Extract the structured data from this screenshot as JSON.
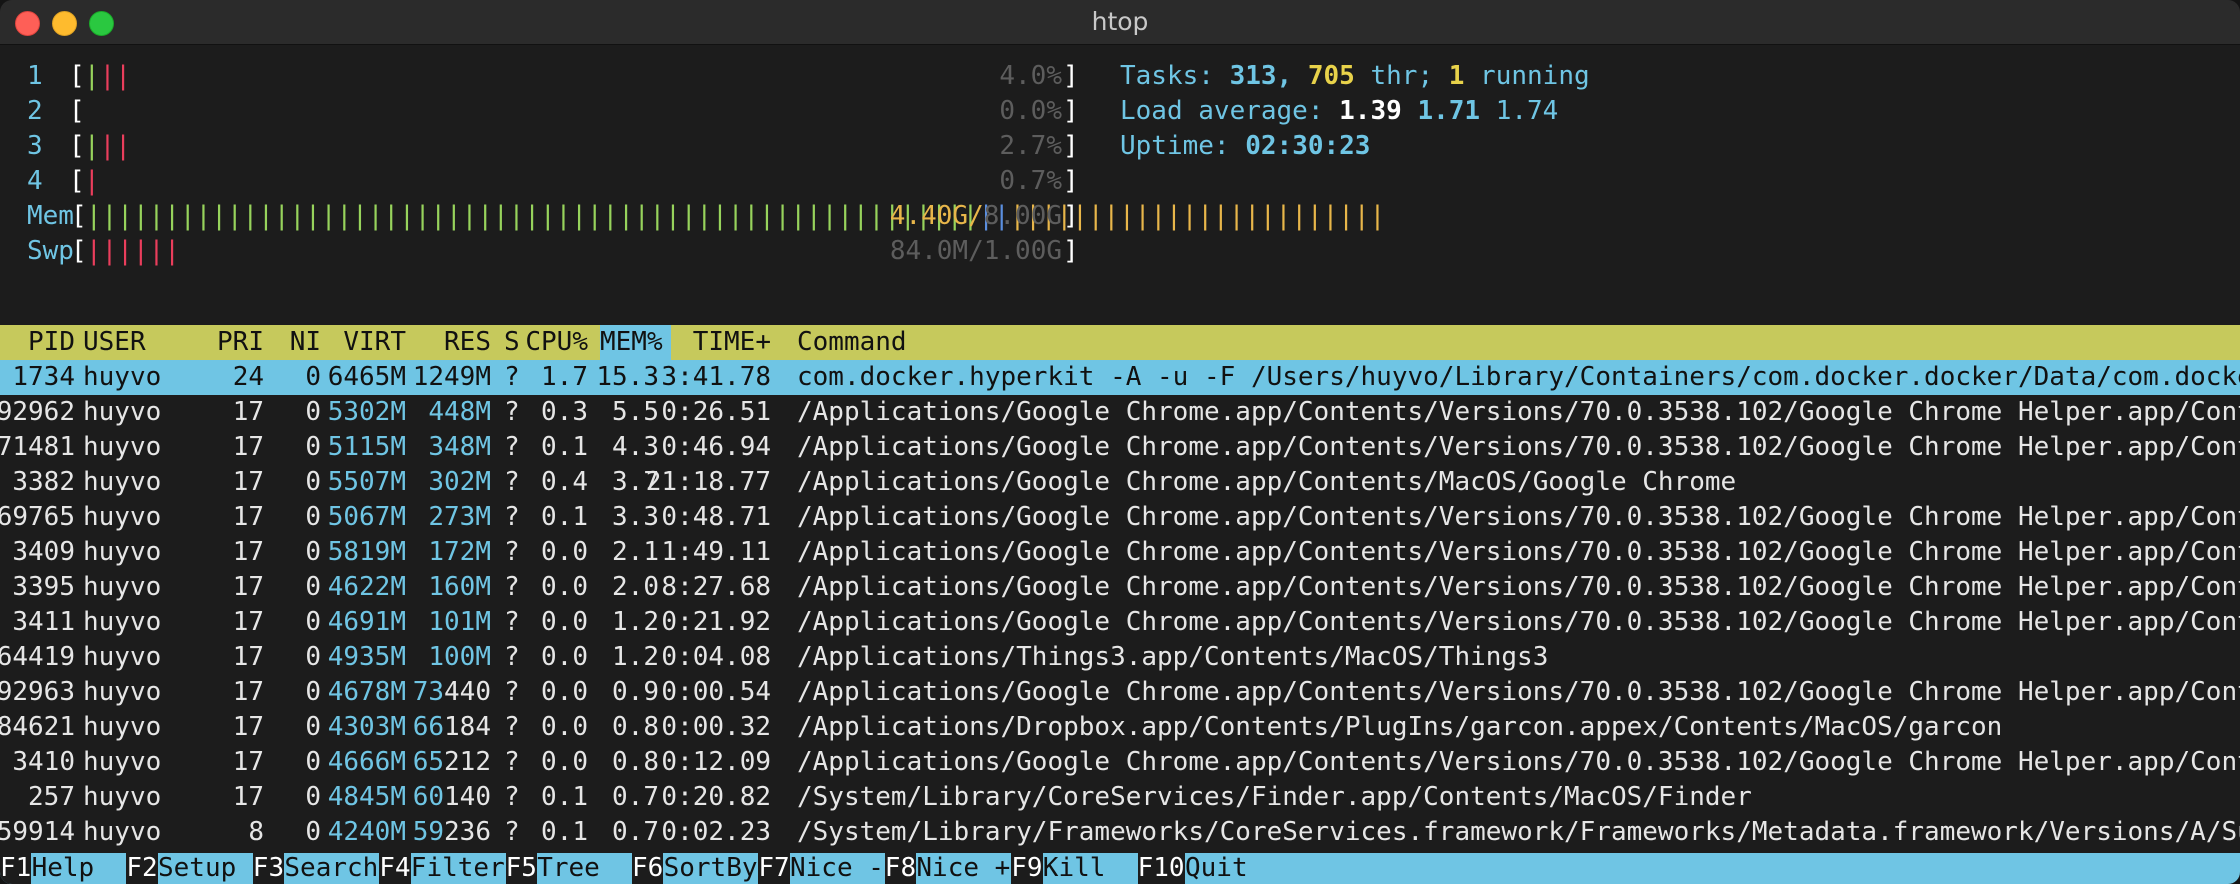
{
  "window": {
    "title": "htop"
  },
  "meters": {
    "cpus": [
      {
        "label": "1",
        "bars": [
          [
            "g",
            1
          ],
          [
            "r",
            2
          ]
        ],
        "value": "4.0%"
      },
      {
        "label": "2",
        "bars": [],
        "value": "0.0%"
      },
      {
        "label": "3",
        "bars": [
          [
            "g",
            1
          ],
          [
            "r",
            2
          ]
        ],
        "value": "2.7%"
      },
      {
        "label": "4",
        "bars": [
          [
            "r",
            1
          ]
        ],
        "value": "0.7%"
      }
    ],
    "mem": {
      "label": "Mem",
      "bars": [
        [
          "g",
          57
        ],
        [
          "b",
          2
        ],
        [
          "y",
          24
        ]
      ],
      "value_used": "4.40G/",
      "value_total": "8.00G"
    },
    "swp": {
      "label": "Swp",
      "bars": [
        [
          "r",
          6
        ]
      ],
      "value": "84.0M/1.00G"
    }
  },
  "info": {
    "tasks_label": "Tasks: ",
    "tasks": "313",
    "sep": ", ",
    "threads": "705",
    "thr_label": " thr; ",
    "running": "1",
    "running_label": " running",
    "load_label": "Load average: ",
    "load1": "1.39",
    "load5": "1.71",
    "load15": "1.74",
    "uptime_label": "Uptime: ",
    "uptime": "02:30:23"
  },
  "columns": [
    "PID",
    "USER",
    "PRI",
    "NI",
    "VIRT",
    "RES",
    "S",
    "CPU%",
    "MEM%",
    "TIME+",
    "Command"
  ],
  "processes": [
    {
      "pid": "1734",
      "user": "huyvo",
      "pri": "24",
      "ni": "0",
      "virt": "6465M",
      "res": "1249M",
      "s": "?",
      "cpu": "1.7",
      "mem": "15.3",
      "time": "3:41.78",
      "cmd": "com.docker.hyperkit -A -u -F /Users/huyvo/Library/Containers/com.docker.docker/Data/com.docker.driver.amd64-linux/hyperkit.pid",
      "selected": true
    },
    {
      "pid": "92962",
      "user": "huyvo",
      "pri": "17",
      "ni": "0",
      "virt": "5302M",
      "res": "448M",
      "s": "?",
      "cpu": "0.3",
      "mem": "5.5",
      "time": "0:26.51",
      "cmd": "/Applications/Google Chrome.app/Contents/Versions/70.0.3538.102/Google Chrome Helper.app/Contents/MacOS/Google Chrome Helper"
    },
    {
      "pid": "71481",
      "user": "huyvo",
      "pri": "17",
      "ni": "0",
      "virt": "5115M",
      "res": "348M",
      "s": "?",
      "cpu": "0.1",
      "mem": "4.3",
      "time": "0:46.94",
      "cmd": "/Applications/Google Chrome.app/Contents/Versions/70.0.3538.102/Google Chrome Helper.app/Contents/MacOS/Google Chrome Helper"
    },
    {
      "pid": "3382",
      "user": "huyvo",
      "pri": "17",
      "ni": "0",
      "virt": "5507M",
      "res": "302M",
      "s": "?",
      "cpu": "0.4",
      "mem": "3.7",
      "time": "21:18.77",
      "cmd": "/Applications/Google Chrome.app/Contents/MacOS/Google Chrome"
    },
    {
      "pid": "69765",
      "user": "huyvo",
      "pri": "17",
      "ni": "0",
      "virt": "5067M",
      "res": "273M",
      "s": "?",
      "cpu": "0.1",
      "mem": "3.3",
      "time": "0:48.71",
      "cmd": "/Applications/Google Chrome.app/Contents/Versions/70.0.3538.102/Google Chrome Helper.app/Contents/MacOS/Google Chrome Helper"
    },
    {
      "pid": "3409",
      "user": "huyvo",
      "pri": "17",
      "ni": "0",
      "virt": "5819M",
      "res": "172M",
      "s": "?",
      "cpu": "0.0",
      "mem": "2.1",
      "time": "1:49.11",
      "cmd": "/Applications/Google Chrome.app/Contents/Versions/70.0.3538.102/Google Chrome Helper.app/Contents/MacOS/Google Chrome Helper"
    },
    {
      "pid": "3395",
      "user": "huyvo",
      "pri": "17",
      "ni": "0",
      "virt": "4622M",
      "res": "160M",
      "s": "?",
      "cpu": "0.0",
      "mem": "2.0",
      "time": "8:27.68",
      "cmd": "/Applications/Google Chrome.app/Contents/Versions/70.0.3538.102/Google Chrome Helper.app/Contents/MacOS/Google Chrome Helper"
    },
    {
      "pid": "3411",
      "user": "huyvo",
      "pri": "17",
      "ni": "0",
      "virt": "4691M",
      "res": "101M",
      "s": "?",
      "cpu": "0.0",
      "mem": "1.2",
      "time": "0:21.92",
      "cmd": "/Applications/Google Chrome.app/Contents/Versions/70.0.3538.102/Google Chrome Helper.app/Contents/MacOS/Google Chrome Helper"
    },
    {
      "pid": "64419",
      "user": "huyvo",
      "pri": "17",
      "ni": "0",
      "virt": "4935M",
      "res": "100M",
      "s": "?",
      "cpu": "0.0",
      "mem": "1.2",
      "time": "0:04.08",
      "cmd": "/Applications/Things3.app/Contents/MacOS/Things3"
    },
    {
      "pid": "92963",
      "user": "huyvo",
      "pri": "17",
      "ni": "0",
      "virt": "4678M",
      "res": "73440",
      "s": "?",
      "cpu": "0.0",
      "mem": "0.9",
      "time": "0:00.54",
      "cmd": "/Applications/Google Chrome.app/Contents/Versions/70.0.3538.102/Google Chrome Helper.app/Contents/MacOS/Google Chrome Helper"
    },
    {
      "pid": "84621",
      "user": "huyvo",
      "pri": "17",
      "ni": "0",
      "virt": "4303M",
      "res": "66184",
      "s": "?",
      "cpu": "0.0",
      "mem": "0.8",
      "time": "0:00.32",
      "cmd": "/Applications/Dropbox.app/Contents/PlugIns/garcon.appex/Contents/MacOS/garcon"
    },
    {
      "pid": "3410",
      "user": "huyvo",
      "pri": "17",
      "ni": "0",
      "virt": "4666M",
      "res": "65212",
      "s": "?",
      "cpu": "0.0",
      "mem": "0.8",
      "time": "0:12.09",
      "cmd": "/Applications/Google Chrome.app/Contents/Versions/70.0.3538.102/Google Chrome Helper.app/Contents/MacOS/Google Chrome Helper"
    },
    {
      "pid": "257",
      "user": "huyvo",
      "pri": "17",
      "ni": "0",
      "virt": "4845M",
      "res": "60140",
      "s": "?",
      "cpu": "0.1",
      "mem": "0.7",
      "time": "0:20.82",
      "cmd": "/System/Library/CoreServices/Finder.app/Contents/MacOS/Finder"
    },
    {
      "pid": "59914",
      "user": "huyvo",
      "pri": "8",
      "ni": "0",
      "virt": "4240M",
      "res": "59236",
      "s": "?",
      "cpu": "0.1",
      "mem": "0.7",
      "time": "0:02.23",
      "cmd": "/System/Library/Frameworks/CoreServices.framework/Frameworks/Metadata.framework/Versions/A/Support/mdworker"
    }
  ],
  "footer": [
    {
      "key": "F1",
      "label": "Help  "
    },
    {
      "key": "F2",
      "label": "Setup "
    },
    {
      "key": "F3",
      "label": "Search"
    },
    {
      "key": "F4",
      "label": "Filter"
    },
    {
      "key": "F5",
      "label": "Tree  "
    },
    {
      "key": "F6",
      "label": "SortBy"
    },
    {
      "key": "F7",
      "label": "Nice -"
    },
    {
      "key": "F8",
      "label": "Nice +"
    },
    {
      "key": "F9",
      "label": "Kill  "
    },
    {
      "key": "F10",
      "label": "Quit  "
    }
  ]
}
